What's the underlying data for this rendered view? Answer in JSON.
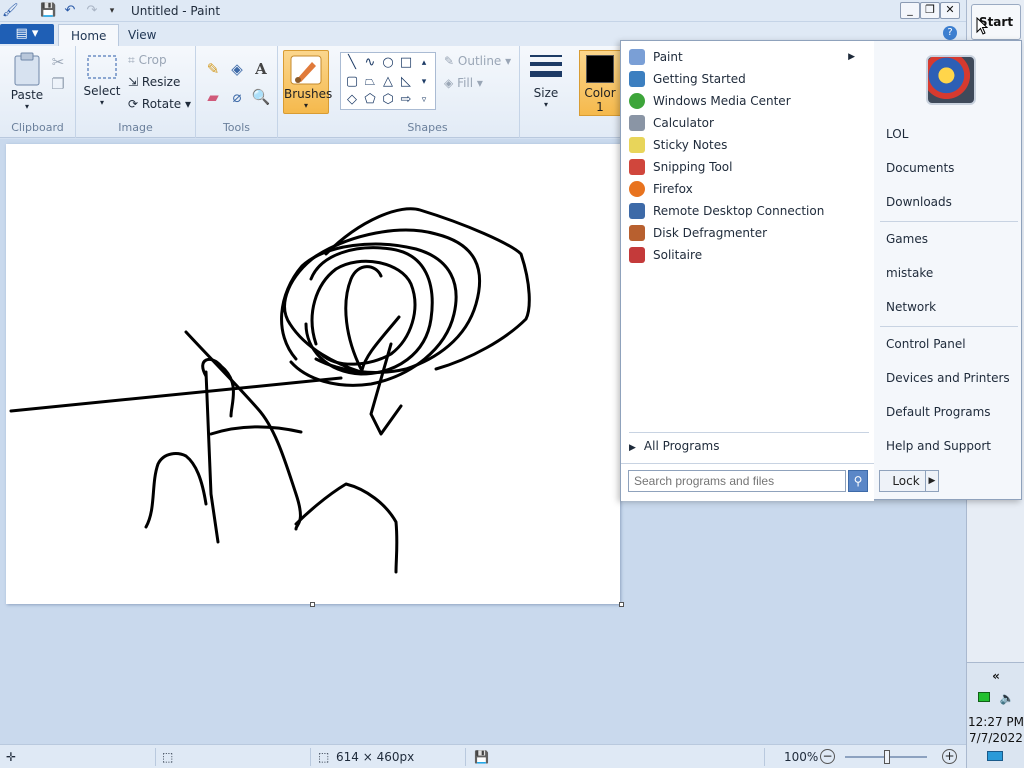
{
  "window": {
    "title": "Untitled - Paint",
    "minimize": "_",
    "restore": "❐",
    "close": "✕"
  },
  "ribbon": {
    "tabs": [
      {
        "label": "Home"
      },
      {
        "label": "View"
      }
    ],
    "file_menu": "▤ ▾",
    "clipboard": {
      "paste": "Paste",
      "group": "Clipboard"
    },
    "image": {
      "select": "Select",
      "crop": "Crop",
      "resize": "Resize",
      "rotate": "Rotate",
      "group": "Image"
    },
    "tools": {
      "group": "Tools"
    },
    "brushes": "Brushes",
    "shapes": {
      "outline": "Outline",
      "fill": "Fill",
      "group": "Shapes"
    },
    "size": "Size",
    "color1": {
      "label": "Color",
      "number": "1",
      "color": "#000000"
    }
  },
  "statusbar": {
    "dimensions": "614 × 460px",
    "zoom": "100%"
  },
  "taskbar": {
    "start": "Start",
    "expand": "«",
    "time": "12:27 PM",
    "date": "7/7/2022"
  },
  "start_menu": {
    "programs": [
      {
        "label": "Paint",
        "icon": "paint-icon",
        "color": "#7a9fd6",
        "submenu": true
      },
      {
        "label": "Getting Started",
        "icon": "getting-started-icon",
        "color": "#3c7fc0"
      },
      {
        "label": "Windows Media Center",
        "icon": "media-center-icon",
        "color": "#3da53a"
      },
      {
        "label": "Calculator",
        "icon": "calculator-icon",
        "color": "#8a95a5"
      },
      {
        "label": "Sticky Notes",
        "icon": "sticky-notes-icon",
        "color": "#e8d55a"
      },
      {
        "label": "Snipping Tool",
        "icon": "snipping-tool-icon",
        "color": "#d0463c"
      },
      {
        "label": "Firefox",
        "icon": "firefox-icon",
        "color": "#e8731f"
      },
      {
        "label": "Remote Desktop Connection",
        "icon": "remote-desktop-icon",
        "color": "#3d6aa8"
      },
      {
        "label": "Disk Defragmenter",
        "icon": "defragmenter-icon",
        "color": "#b8602f"
      },
      {
        "label": "Solitaire",
        "icon": "solitaire-icon",
        "color": "#c43a3a"
      }
    ],
    "all_programs": "All Programs",
    "search_placeholder": "Search programs and files",
    "right_links": [
      {
        "label": "LOL"
      },
      {
        "label": "Documents"
      },
      {
        "label": "Downloads"
      },
      {
        "label": "Games"
      },
      {
        "label": "mistake"
      },
      {
        "label": "Network"
      },
      {
        "label": "Control Panel"
      },
      {
        "label": "Devices and Printers"
      },
      {
        "label": "Default Programs"
      },
      {
        "label": "Help and Support"
      }
    ],
    "lock": "Lock"
  }
}
